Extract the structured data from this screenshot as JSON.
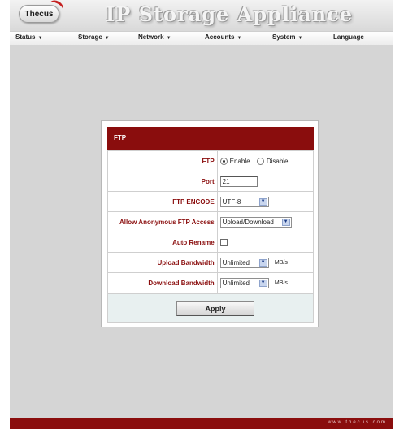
{
  "header": {
    "logo_text": "Thecus",
    "title": "IP Storage Appliance"
  },
  "menu": {
    "items": [
      {
        "label": "Status",
        "caret": "▼"
      },
      {
        "label": "Storage",
        "caret": "▼"
      },
      {
        "label": "Network",
        "caret": "▼"
      },
      {
        "label": "Accounts",
        "caret": "▼"
      },
      {
        "label": "System",
        "caret": "▼"
      },
      {
        "label": "Language",
        "caret": ""
      }
    ]
  },
  "panel": {
    "title": "FTP",
    "rows": {
      "ftp": {
        "label": "FTP",
        "option_enable": "Enable",
        "option_disable": "Disable",
        "selected": "Enable"
      },
      "port": {
        "label": "Port",
        "value": "21"
      },
      "encode": {
        "label": "FTP ENCODE",
        "value": "UTF-8"
      },
      "anonymous": {
        "label": "Allow Anonymous FTP Access",
        "value": "Upload/Download"
      },
      "auto_rename": {
        "label": "Auto Rename",
        "checked": false
      },
      "upload_bw": {
        "label": "Upload Bandwidth",
        "value": "Unlimited",
        "unit": "MB/s"
      },
      "download_bw": {
        "label": "Download Bandwidth",
        "value": "Unlimited",
        "unit": "MB/s"
      }
    },
    "apply_label": "Apply"
  },
  "footer": {
    "url_text": "www.thecus.com"
  },
  "colors": {
    "brand_red": "#8a0d0d",
    "content_bg": "#d5d5d5",
    "label_red": "#8a0d0d"
  },
  "icons": {
    "dropdown": "chevron-down-icon",
    "radio_on": "radio-selected-icon",
    "radio_off": "radio-unselected-icon"
  }
}
